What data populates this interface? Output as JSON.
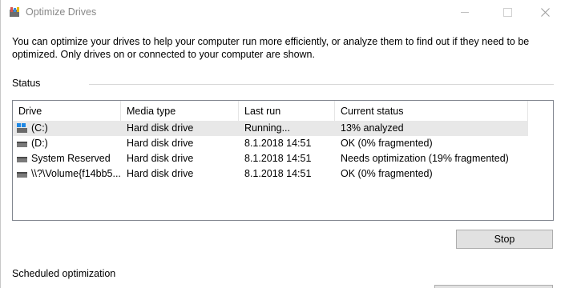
{
  "window": {
    "title": "Optimize Drives"
  },
  "intro_text": "You can optimize your drives to help your computer run more efficiently, or analyze them to find out if they need to be optimized. Only drives on or connected to your computer are shown.",
  "status_section": {
    "label": "Status",
    "columns": [
      "Drive",
      "Media type",
      "Last run",
      "Current status"
    ],
    "rows": [
      {
        "drive": "(C:)",
        "icon": "system-drive-icon",
        "media": "Hard disk drive",
        "last_run": "Running...",
        "status": "13% analyzed"
      },
      {
        "drive": "(D:)",
        "icon": "hard-drive-icon",
        "media": "Hard disk drive",
        "last_run": "8.1.2018 14:51",
        "status": "OK (0% fragmented)"
      },
      {
        "drive": "System Reserved",
        "icon": "hard-drive-icon",
        "media": "Hard disk drive",
        "last_run": "8.1.2018 14:51",
        "status": "Needs optimization (19% fragmented)"
      },
      {
        "drive": "\\\\?\\Volume{f14bb5...",
        "icon": "hard-drive-icon",
        "media": "Hard disk drive",
        "last_run": "8.1.2018 14:51",
        "status": "OK (0% fragmented)"
      }
    ],
    "stop_label": "Stop"
  },
  "scheduled_section": {
    "label": "Scheduled optimization"
  }
}
